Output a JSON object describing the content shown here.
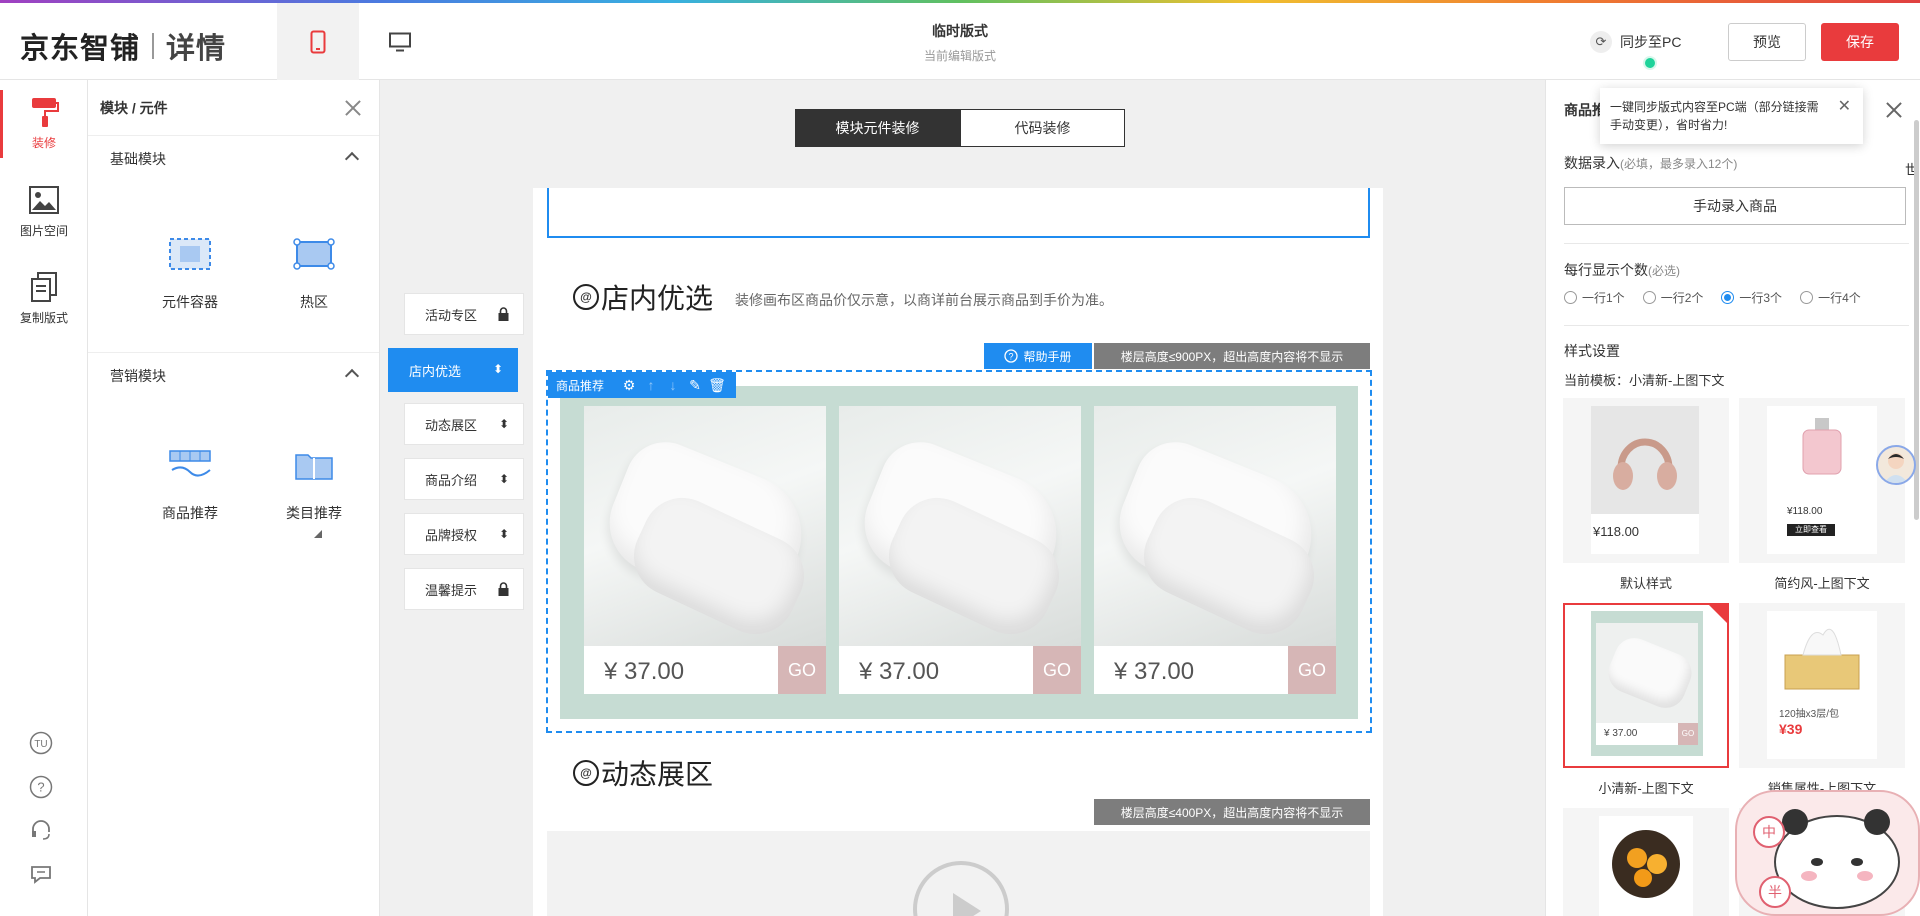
{
  "header": {
    "logo_main": "京东智铺",
    "logo_sub": "详情",
    "layout_title": "临时版式",
    "layout_subtitle": "当前编辑版式",
    "sync_label": "同步至PC",
    "preview_label": "预览",
    "save_label": "保存"
  },
  "rail": {
    "items": [
      {
        "label": "装修",
        "icon": "paint-roller-icon"
      },
      {
        "label": "图片空间",
        "icon": "image-icon"
      },
      {
        "label": "复制版式",
        "icon": "copy-icon"
      }
    ],
    "bottom_icons": [
      "tu-icon",
      "help-icon",
      "customer-service-icon",
      "feedback-icon"
    ],
    "tu_text": "TU",
    "help_text": "?"
  },
  "module_panel": {
    "title": "模块 / 元件",
    "sections": [
      {
        "title": "基础模块",
        "items": [
          {
            "label": "元件容器"
          },
          {
            "label": "热区"
          }
        ]
      },
      {
        "title": "营销模块",
        "items": [
          {
            "label": "商品推荐"
          },
          {
            "label": "类目推荐"
          }
        ]
      }
    ]
  },
  "canvas": {
    "tabs": [
      {
        "label": "模块元件装修"
      },
      {
        "label": "代码装修"
      }
    ],
    "floor_nav": [
      {
        "label": "活动专区",
        "icon": "lock-icon"
      },
      {
        "label": "店内优选",
        "icon": "drag-icon"
      },
      {
        "label": "动态展区",
        "icon": "drag-icon"
      },
      {
        "label": "商品介绍",
        "icon": "drag-icon"
      },
      {
        "label": "品牌授权",
        "icon": "drag-icon"
      },
      {
        "label": "温馨提示",
        "icon": "lock-icon"
      }
    ],
    "floor1": {
      "icon_text": "@",
      "title": "店内优选",
      "note": "装修画布区商品价仅示意，以商详前台展示商品到手价为准。",
      "help_label": "帮助手册",
      "height_tag": "楼层高度≤900PX，超出高度内容将不显示"
    },
    "rec_module": {
      "toolbar_label": "商品推荐",
      "products": [
        {
          "price": "¥ 37.00",
          "go": "GO"
        },
        {
          "price": "¥ 37.00",
          "go": "GO"
        },
        {
          "price": "¥ 37.00",
          "go": "GO"
        }
      ]
    },
    "floor2": {
      "icon_text": "@",
      "title": "动态展区",
      "height_tag": "楼层高度≤400PX，超出高度内容将不显示"
    }
  },
  "right_panel": {
    "title": "商品推",
    "tooltip": "一键同步版式内容至PC端（部分链接需手动变更），省时省力!",
    "data_entry_label": "数据录入",
    "data_entry_hint": "(必填，最多录入12个)",
    "manual_btn": "手动录入商品",
    "per_row_label": "每行显示个数",
    "per_row_hint": "(必选)",
    "per_row_options": [
      "一行1个",
      "一行2个",
      "一行3个",
      "一行4个"
    ],
    "per_row_selected": "一行3个",
    "style_label": "样式设置",
    "current_template": "当前模板：小清新-上图下文",
    "templates": [
      {
        "caption": "默认样式",
        "price": "¥118.00"
      },
      {
        "caption": "简约风-上图下文",
        "price": "¥118.00",
        "btn": "立即查看"
      },
      {
        "caption": "小清新-上图下文",
        "price": "¥ 37.00",
        "go": "GO",
        "selected": true
      },
      {
        "caption": "销售属性-上图下文",
        "desc": "120抽x3层/包",
        "price": "¥39"
      }
    ],
    "edge_glyph": "世",
    "mascot_chars": [
      "中",
      "半"
    ]
  }
}
